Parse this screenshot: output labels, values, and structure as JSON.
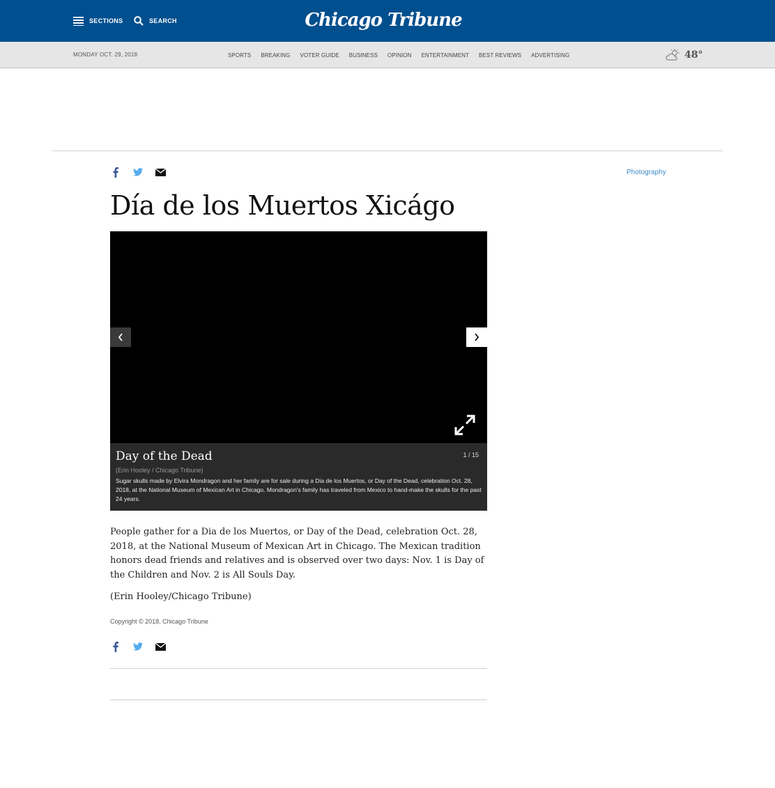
{
  "header": {
    "sections_label": "SECTIONS",
    "search_label": "SEARCH",
    "logo_text": "Chicago Tribune"
  },
  "navbar": {
    "date": "MONDAY OCT. 29, 2018",
    "links": [
      "SPORTS",
      "BREAKING",
      "VOTER GUIDE",
      "BUSINESS",
      "OPINION",
      "ENTERTAINMENT",
      "BEST REVIEWS",
      "ADVERTISING"
    ],
    "weather_temp": "48°",
    "weather_icon": "partly-cloudy-icon"
  },
  "article": {
    "section": "Photography",
    "headline": "Día de los Muertos Xicágo",
    "body": "People gather for a Dia de los Muertos, or Day of the Dead, celebration Oct. 28, 2018, at the National Museum of Mexican Art in Chicago. The Mexican tradition honors dead friends and relatives and is observed over two days: Nov. 1 is Day of the Children and Nov. 2 is All Souls Day.",
    "credit": "(Erin Hooley/Chicago Tribune)",
    "copyright": "Copyright © 2018, Chicago Tribune"
  },
  "gallery": {
    "caption_title": "Day of the Dead",
    "counter": "1 / 15",
    "photo_credit": "(Erin Hooley / Chicago Tribune)",
    "caption_text": "Sugar skulls made by Elvira Mondragon and her family are for sale during a Dia de los Muertos, or Day of the Dead, celebration Oct. 28, 2018, at the National Museum of Mexican Art in Chicago. Mondragon's family has traveled from Mexico to hand-make the skulls for the past 24 years."
  },
  "colors": {
    "brand_blue": "#004f8e",
    "link_blue": "#3d8bc6",
    "facebook": "#3b5998",
    "twitter": "#55acee"
  }
}
